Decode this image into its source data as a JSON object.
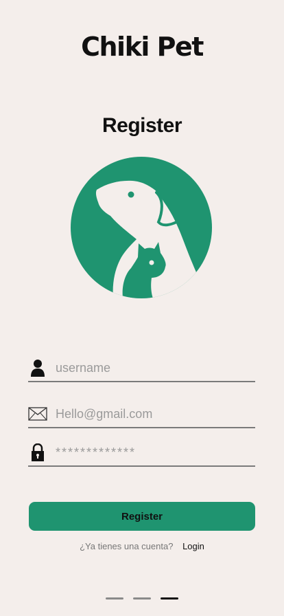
{
  "app": {
    "brand": "Chiki Pet"
  },
  "page": {
    "title": "Register"
  },
  "form": {
    "username": {
      "icon": "user-icon",
      "placeholder": "username",
      "value": ""
    },
    "email": {
      "icon": "mail-icon",
      "placeholder": "Hello@gmail.com",
      "value": ""
    },
    "password": {
      "icon": "lock-icon",
      "placeholder": "*************",
      "value": ""
    },
    "submit_label": "Register"
  },
  "footer": {
    "question": "¿Ya tienes una cuenta?",
    "login_label": "Login"
  },
  "pager": {
    "count": 3,
    "active": 3
  },
  "colors": {
    "accent": "#1f9470",
    "background": "#f4eeeb"
  }
}
